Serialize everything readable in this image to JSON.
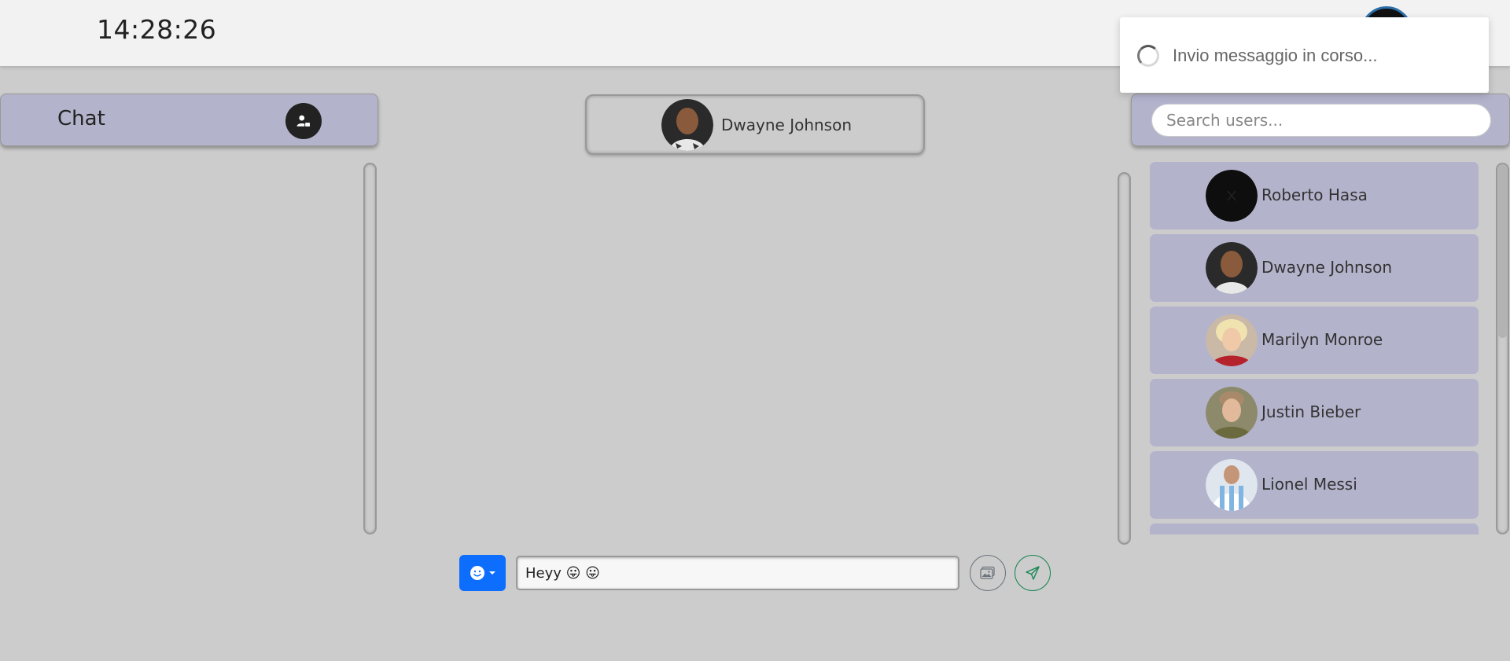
{
  "topbar": {
    "clock": "14:28:26"
  },
  "toast": {
    "message": "Invio messaggio in corso..."
  },
  "chat_panel": {
    "title": "Chat"
  },
  "conversation": {
    "contact_name": "Dwayne Johnson"
  },
  "search": {
    "placeholder": "Search users..."
  },
  "users": [
    {
      "name": "Roberto Hasa"
    },
    {
      "name": "Dwayne Johnson"
    },
    {
      "name": "Marilyn Monroe"
    },
    {
      "name": "Justin Bieber"
    },
    {
      "name": "Lionel Messi"
    }
  ],
  "composer": {
    "message": "Heyy 😛 😛"
  },
  "colors": {
    "panel": "#b3b3cc",
    "background": "#cccccc",
    "primary": "#0d6efd",
    "send": "#198754"
  },
  "icons": {
    "add_user": "person-plus-icon",
    "emoji": "smiley-icon",
    "image": "image-icon",
    "send": "send-icon"
  }
}
